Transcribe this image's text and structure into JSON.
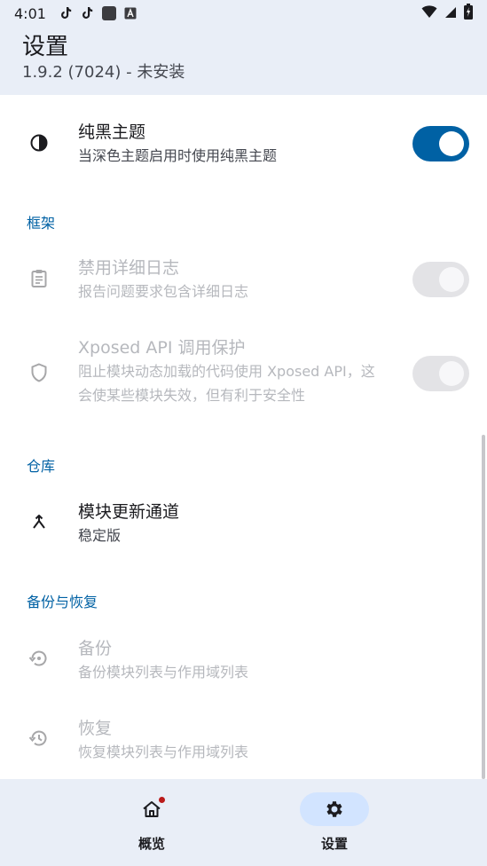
{
  "status_bar": {
    "time": "4:01",
    "icons": [
      "tiktok-icon",
      "tiktok-icon",
      "app-square-icon",
      "notification-a-icon"
    ],
    "right_icons": [
      "wifi-icon",
      "signal-icon",
      "battery-charging-icon"
    ]
  },
  "header": {
    "title": "设置",
    "subtitle": "1.9.2 (7024) - 未安装"
  },
  "prefs": {
    "black_theme": {
      "title": "纯黑主题",
      "summary": "当深色主题启用时使用纯黑主题",
      "icon": "contrast-icon",
      "enabled": true,
      "checked": true
    },
    "category_framework": "框架",
    "disable_verbose_log": {
      "title": "禁用详细日志",
      "summary": "报告问题要求包含详细日志",
      "icon": "clipboard-icon",
      "enabled": false
    },
    "xposed_api_protection": {
      "title": "Xposed API 调用保护",
      "summary_line1": "阻止模块动态加载的代码使用 Xposed API，这",
      "summary_line2": "会使某些模块失效，但有利于安全性",
      "icon": "shield-icon",
      "enabled": false
    },
    "category_repo": "仓库",
    "update_channel": {
      "title": "模块更新通道",
      "summary": "稳定版",
      "icon": "merge-icon"
    },
    "category_backup": "备份与恢复",
    "backup": {
      "title": "备份",
      "summary": "备份模块列表与作用域列表",
      "icon": "backup-restore-icon",
      "enabled": false
    },
    "restore": {
      "title": "恢复",
      "summary": "恢复模块列表与作用域列表",
      "icon": "history-icon",
      "enabled": false
    }
  },
  "nav": {
    "overview_label": "概览",
    "settings_label": "设置",
    "active": "settings"
  },
  "colors": {
    "accent": "#0061a4",
    "surface": "#e9eef7",
    "badge": "#ba1a1a"
  }
}
